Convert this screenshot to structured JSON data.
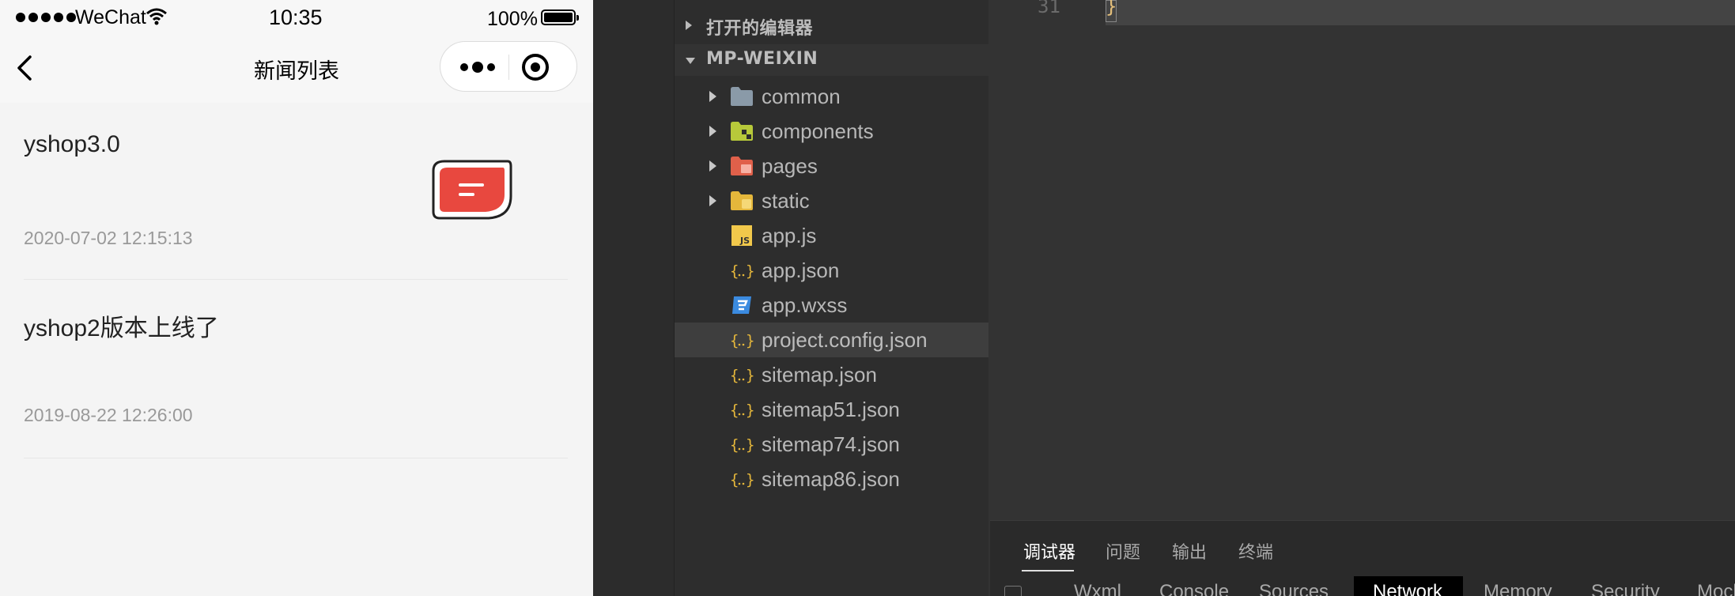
{
  "status_bar": {
    "carrier": "WeChat",
    "time": "10:35",
    "battery_pct": "100%"
  },
  "nav": {
    "title": "新闻列表"
  },
  "news": [
    {
      "title": "yshop3.0",
      "date": "2020-07-02 12:15:13"
    },
    {
      "title": "yshop2版本上线了",
      "date": "2019-08-22 12:26:00"
    }
  ],
  "explorer": {
    "open_editors_label": "打开的编辑器",
    "project_label": "MP-WEIXIN",
    "items": [
      {
        "name": "common",
        "icon": "folder-icon",
        "folder": true
      },
      {
        "name": "components",
        "icon": "components-folder-icon",
        "folder": true
      },
      {
        "name": "pages",
        "icon": "pages-folder-icon",
        "folder": true
      },
      {
        "name": "static",
        "icon": "static-folder-icon",
        "folder": true
      },
      {
        "name": "app.js",
        "icon": "js-file-icon",
        "folder": false
      },
      {
        "name": "app.json",
        "icon": "json-file-icon",
        "folder": false
      },
      {
        "name": "app.wxss",
        "icon": "css-file-icon",
        "folder": false
      },
      {
        "name": "project.config.json",
        "icon": "json-file-icon",
        "folder": false,
        "selected": true
      },
      {
        "name": "sitemap.json",
        "icon": "json-file-icon",
        "folder": false
      },
      {
        "name": "sitemap51.json",
        "icon": "json-file-icon",
        "folder": false
      },
      {
        "name": "sitemap74.json",
        "icon": "json-file-icon",
        "folder": false
      },
      {
        "name": "sitemap86.json",
        "icon": "json-file-icon",
        "folder": false
      }
    ]
  },
  "code": {
    "line_number": "31",
    "line_text": "}"
  },
  "panel": {
    "tabs": [
      "调试器",
      "问题",
      "输出",
      "终端"
    ],
    "active_tab": "调试器",
    "subtabs": [
      "Wxml",
      "Console",
      "Sources",
      "Network",
      "Memory",
      "Security",
      "Mock"
    ],
    "active_subtab": "Network"
  },
  "colors": {
    "editor_bg": "#333333",
    "explorer_bg": "#2d2d2d",
    "json_icon": "#e5b73b",
    "js_icon": "#f1c84b",
    "css_icon": "#3b8be0",
    "news_thumb": "#e8483f"
  }
}
